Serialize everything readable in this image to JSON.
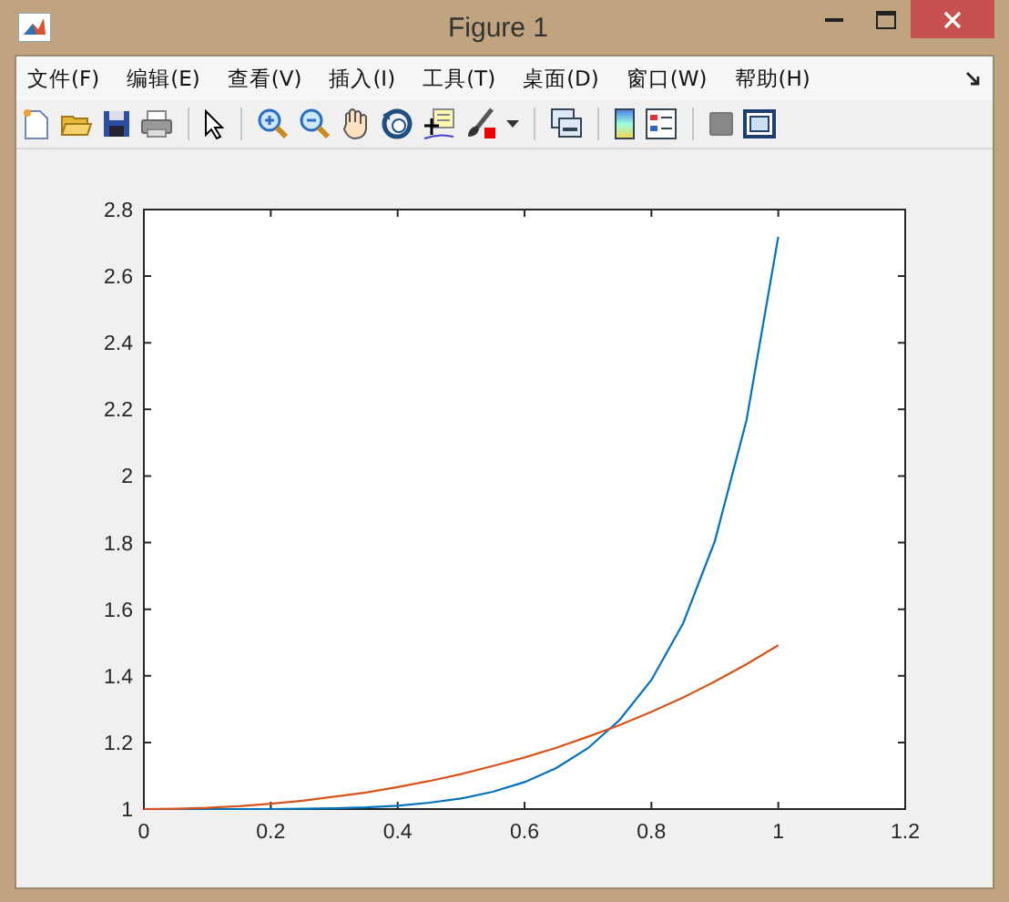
{
  "window": {
    "title": "Figure 1"
  },
  "menu": [
    "文件(F)",
    "编辑(E)",
    "查看(V)",
    "插入(I)",
    "工具(T)",
    "桌面(D)",
    "窗口(W)",
    "帮助(H)"
  ],
  "plot": {
    "chart_data": {
      "type": "line",
      "x": [
        0,
        0.05,
        0.1,
        0.15,
        0.2,
        0.25,
        0.3,
        0.35,
        0.4,
        0.45,
        0.5,
        0.55,
        0.6,
        0.65,
        0.7,
        0.75,
        0.8,
        0.85,
        0.9,
        0.95,
        1
      ],
      "series": [
        {
          "color": "#0072bd",
          "values": [
            1,
            1,
            1,
            1,
            1,
            1.001,
            1.002,
            1.005,
            1.01,
            1.019,
            1.032,
            1.052,
            1.081,
            1.123,
            1.183,
            1.268,
            1.388,
            1.558,
            1.805,
            2.168,
            2.718
          ]
        },
        {
          "color": "#d95319",
          "values": [
            1,
            1.001,
            1.004,
            1.009,
            1.016,
            1.025,
            1.037,
            1.05,
            1.066,
            1.084,
            1.105,
            1.129,
            1.155,
            1.184,
            1.217,
            1.252,
            1.292,
            1.335,
            1.383,
            1.435,
            1.492
          ]
        }
      ],
      "xlim": [
        0,
        1.2
      ],
      "ylim": [
        1,
        2.8
      ],
      "xticks": [
        {
          "value": 0,
          "label": "0"
        },
        {
          "value": 0.2,
          "label": "0.2"
        },
        {
          "value": 0.4,
          "label": "0.4"
        },
        {
          "value": 0.6,
          "label": "0.6"
        },
        {
          "value": 0.8,
          "label": "0.8"
        },
        {
          "value": 1,
          "label": "1"
        },
        {
          "value": 1.2,
          "label": "1.2"
        }
      ],
      "yticks": [
        {
          "value": 1,
          "label": "1"
        },
        {
          "value": 1.2,
          "label": "1.2"
        },
        {
          "value": 1.4,
          "label": "1.4"
        },
        {
          "value": 1.6,
          "label": "1.6"
        },
        {
          "value": 1.8,
          "label": "1.8"
        },
        {
          "value": 2,
          "label": "2"
        },
        {
          "value": 2.2,
          "label": "2.2"
        },
        {
          "value": 2.4,
          "label": "2.4"
        },
        {
          "value": 2.6,
          "label": "2.6"
        },
        {
          "value": 2.8,
          "label": "2.8"
        }
      ]
    }
  }
}
